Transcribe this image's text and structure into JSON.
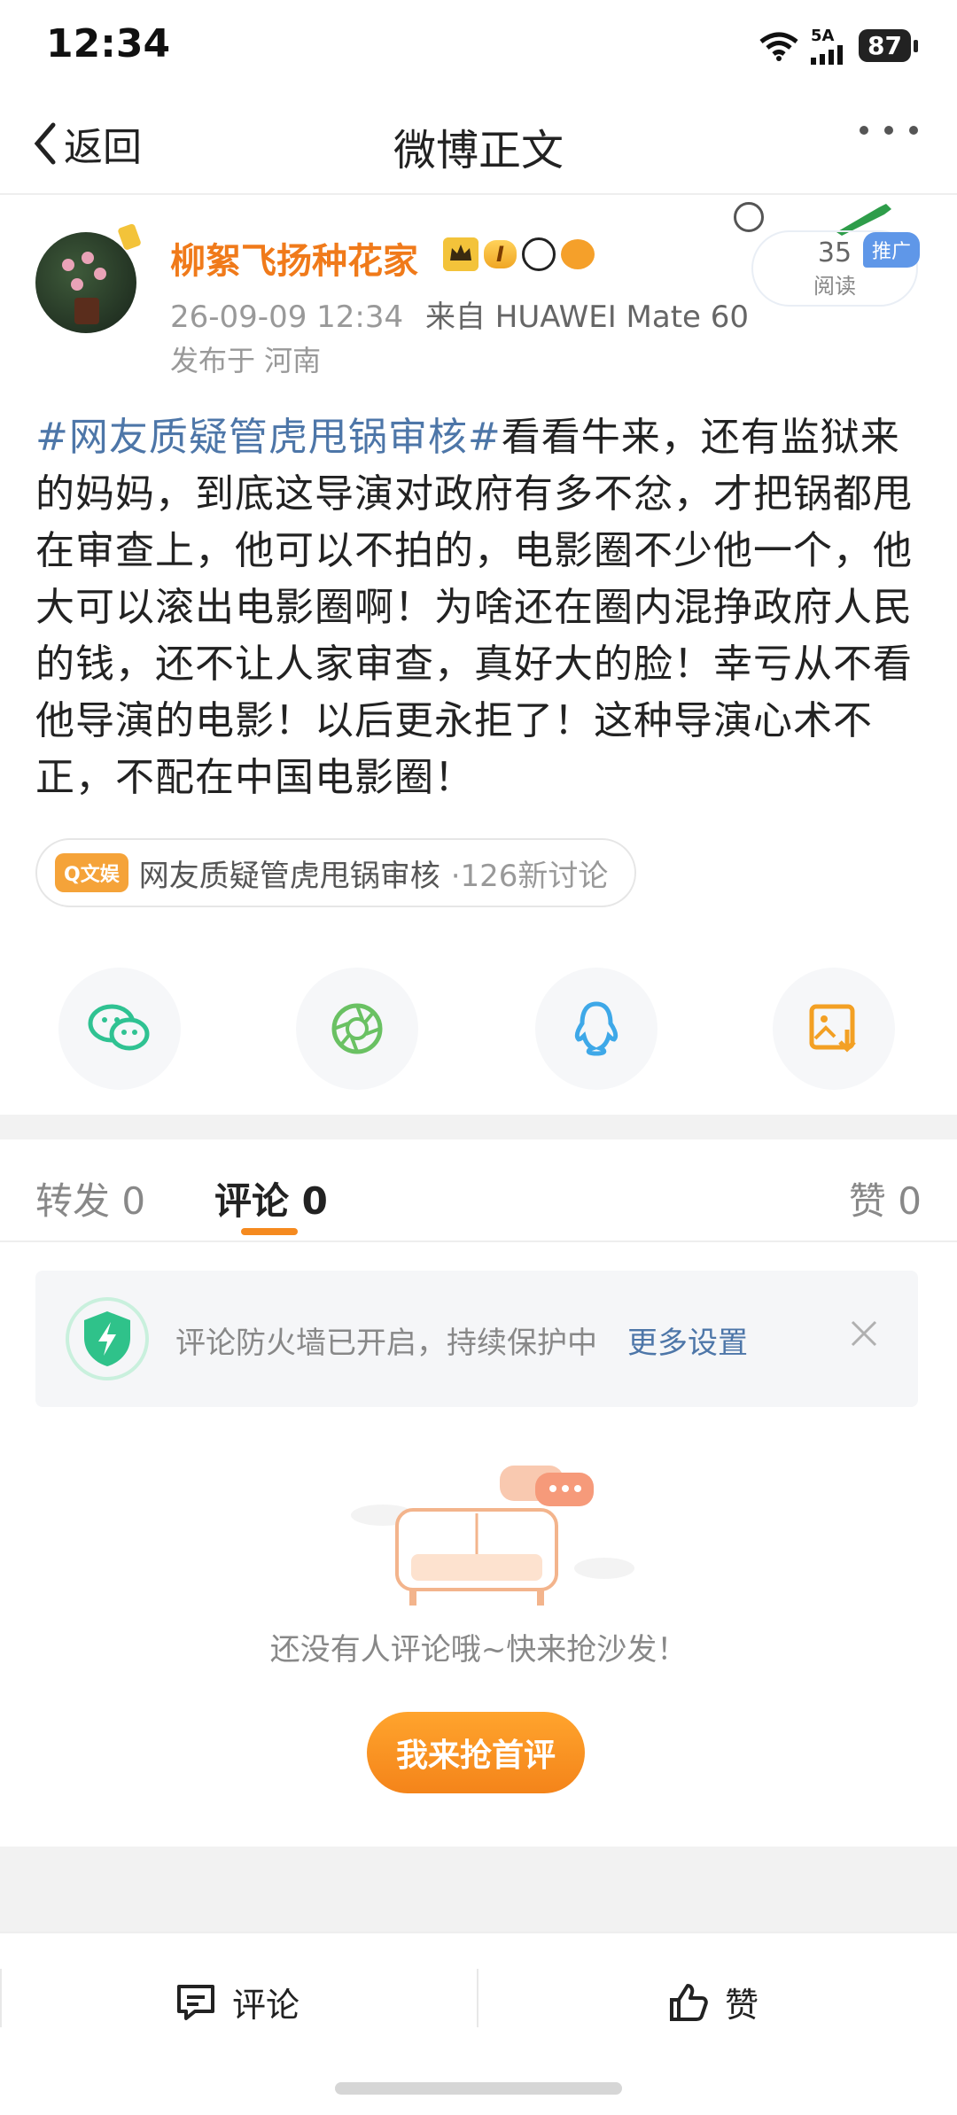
{
  "status_bar": {
    "time": "12:34",
    "network": "5A",
    "battery": "87"
  },
  "nav": {
    "back_label": "返回",
    "title": "微博正文"
  },
  "author": {
    "name": "柳絮飞扬种花家",
    "vip_level": "I"
  },
  "post": {
    "time": "26-09-09 12:34",
    "via_prefix": "来自",
    "device": "HUAWEI Mate 60",
    "location": "发布于 河南",
    "read_count": "35",
    "read_label": "阅读",
    "ad_tag": "推广",
    "topic": "#网友质疑管虎甩锅审核#",
    "content": "看看牛来，还有监狱来的妈妈，到底这导演对政府有多不忿，才把锅都甩在审查上，他可以不拍的，电影圈不少他一个，他大可以滚出电影圈啊！为啥还在圈内混挣政府人民的钱，还不让人家审查，真好大的脸！幸亏从不看他导演的电影！以后更永拒了！这种导演心术不正，不配在中国电影圈！"
  },
  "topic_chip": {
    "tag": "Q文娱",
    "name": "网友质疑管虎甩锅审核",
    "count": "·126新讨论"
  },
  "share": [
    {
      "icon": "wechat-icon",
      "color": "#2fc292"
    },
    {
      "icon": "moments-icon",
      "color": "#6ac163"
    },
    {
      "icon": "qq-icon",
      "color": "#3ea8e8"
    },
    {
      "icon": "save-image-icon",
      "color": "#f3a024"
    }
  ],
  "tabs": {
    "repost": "转发 0",
    "comment": "评论 0",
    "like": "赞 0"
  },
  "firewall": {
    "text": "评论防火墙已开启，持续保护中",
    "link": "更多设置"
  },
  "empty": {
    "text": "还没有人评论哦~快来抢沙发！",
    "button": "我来抢首评"
  },
  "bottom_bar": {
    "comment": "评论",
    "like": "赞"
  }
}
